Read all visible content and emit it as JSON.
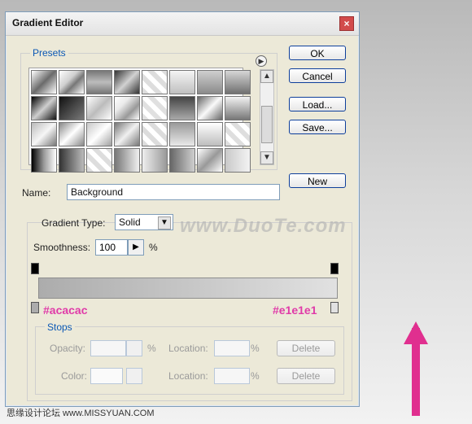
{
  "window": {
    "title": "Gradient Editor"
  },
  "presets": {
    "legend": "Presets",
    "swatches": [
      [
        "#6b6b6b",
        "#cfcfcf",
        "#9b9b9b",
        "#8a8a8a",
        "#ebebeb",
        "#bfbfbf",
        "#9c9c9c",
        "#7a7a7a"
      ],
      [
        "#202020",
        "#4b4b4b",
        "#bcbcbc",
        "#e9e9e9",
        "#f1f1f1",
        "#6b6b6b",
        "#a6a6a6",
        "#e2e2e2"
      ],
      [
        "#9a9a9a",
        "#d1d1d1",
        "#dcdcdc",
        "#e1e1e1",
        "#d7d7d7",
        "#bcbcbc",
        "#efefef",
        "#d5d5d5"
      ],
      [
        "#1c1c1c",
        "#595959",
        "#e4e4e4",
        "#bdbdbd",
        "#f0f0f0",
        "#767676",
        "#a7a7a7",
        "#cfcfcf"
      ]
    ]
  },
  "buttons": {
    "ok": "OK",
    "cancel": "Cancel",
    "load": "Load...",
    "save": "Save...",
    "new": "New"
  },
  "name": {
    "label": "Name:",
    "value": "Background"
  },
  "gradient": {
    "type_label": "Gradient Type:",
    "type_value": "Solid",
    "smoothness_label": "Smoothness:",
    "smoothness_value": "100",
    "percent": "%"
  },
  "watermark": {
    "duote": "www.DuoTe.com",
    "footer": "思缘设计论坛 www.MISSYUAN.COM"
  },
  "gradient_bar": {
    "left_hex": "#acacac",
    "right_hex": "#e1e1e1",
    "left_label": "#acacac",
    "right_label": "#e1e1e1"
  },
  "stops": {
    "legend": "Stops",
    "opacity_label": "Opacity:",
    "location_label": "Location:",
    "color_label": "Color:",
    "percent": "%",
    "delete": "Delete"
  }
}
